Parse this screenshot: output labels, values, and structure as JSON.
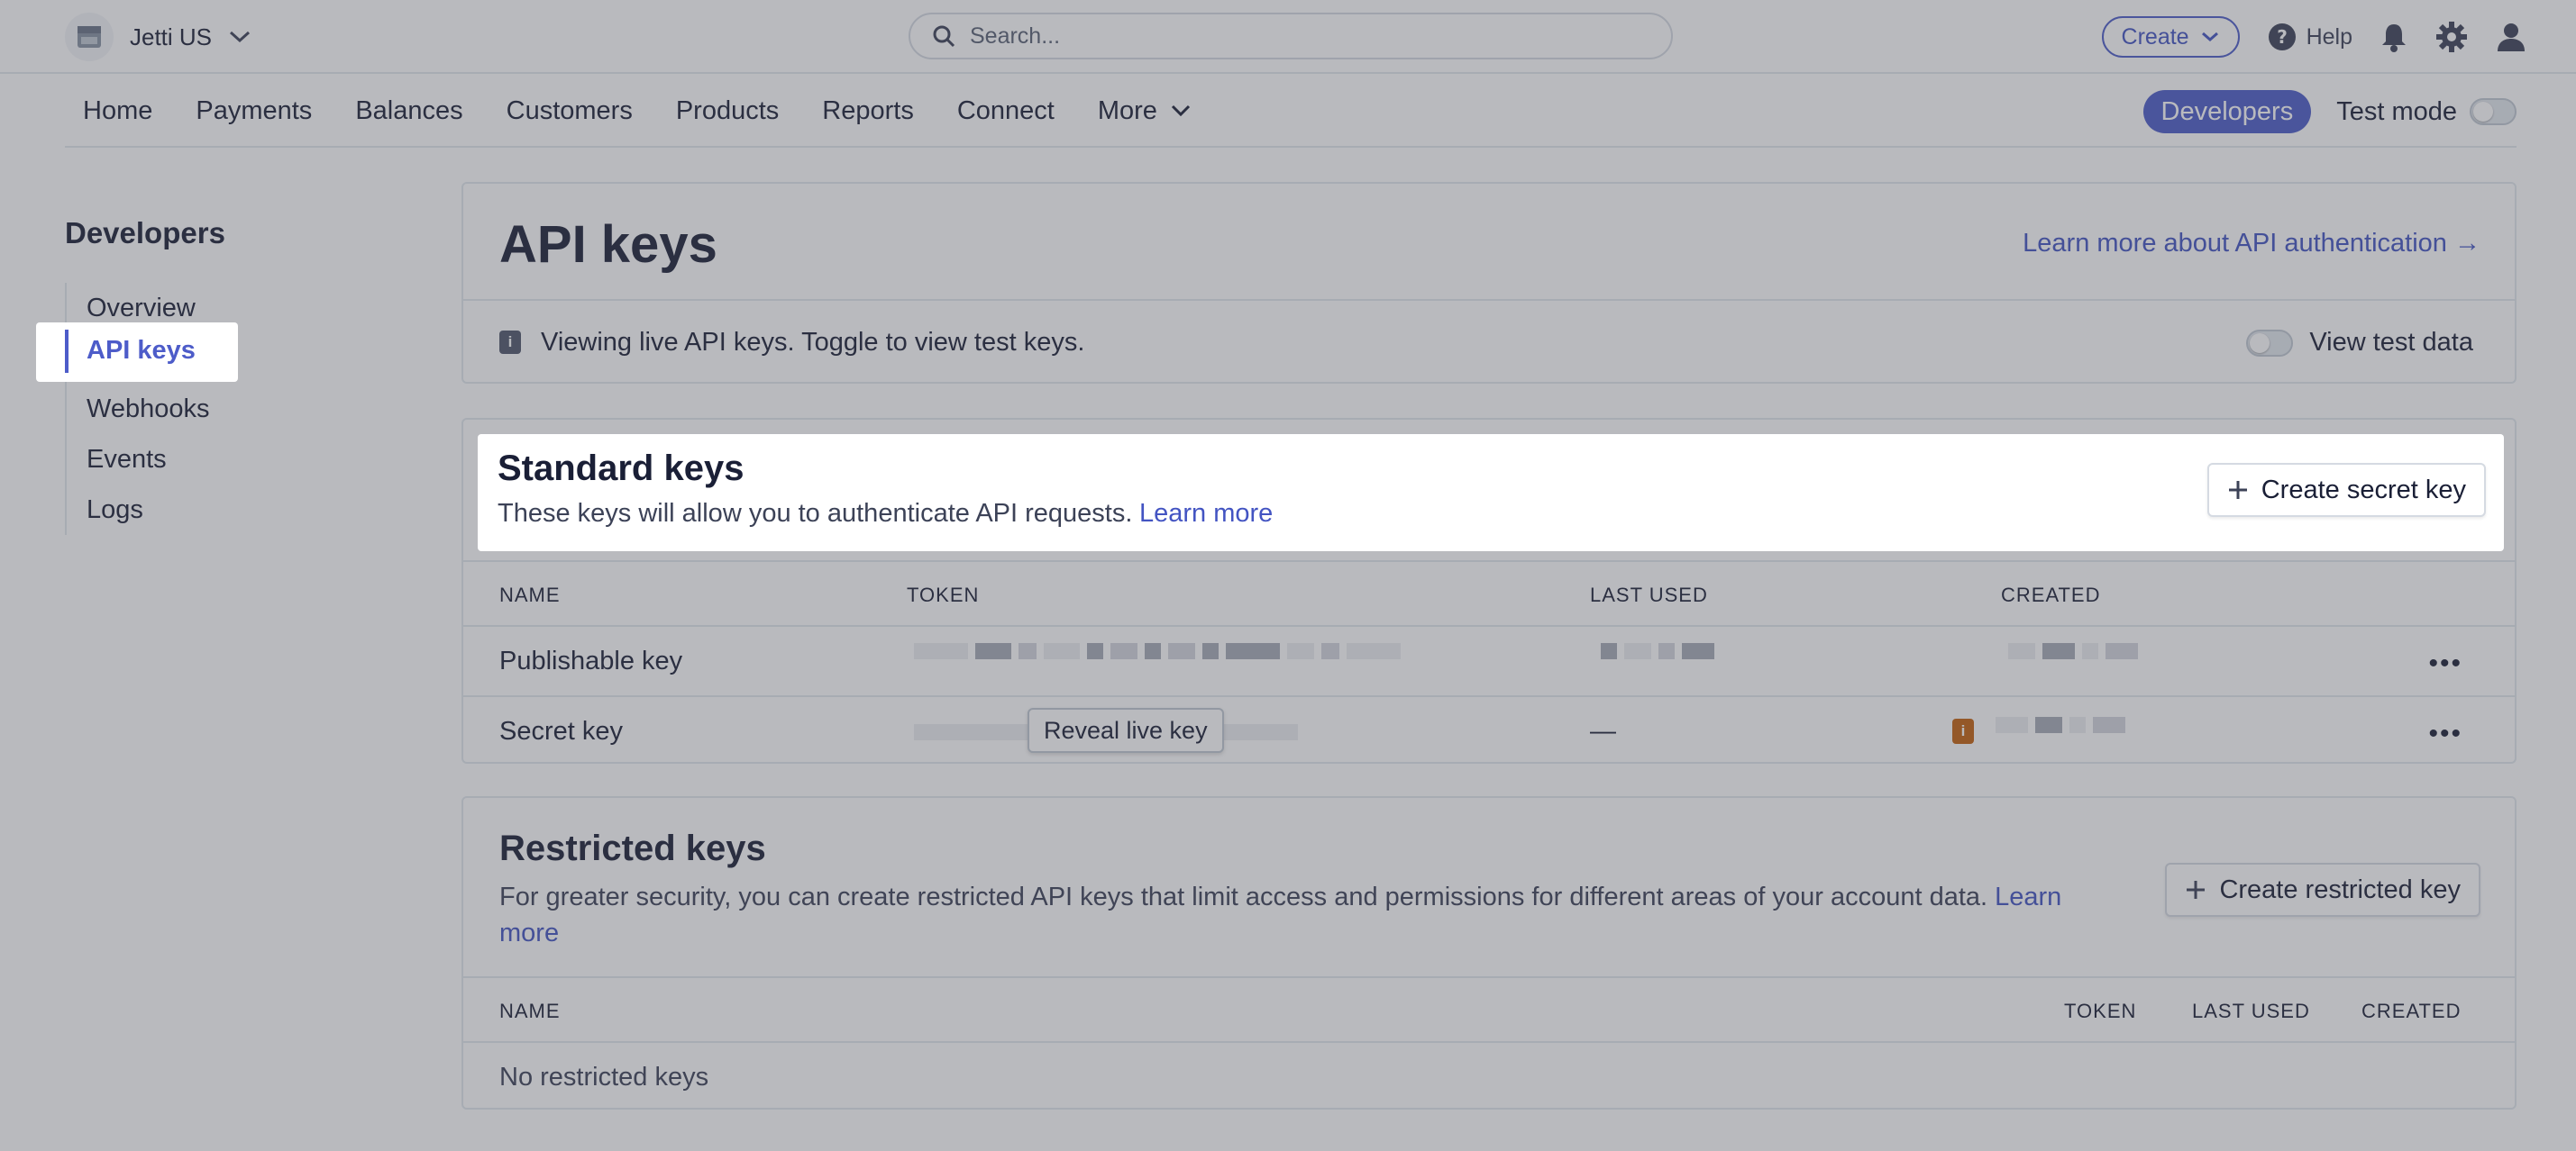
{
  "header": {
    "account_name": "Jetti US",
    "search_placeholder": "Search...",
    "create_label": "Create",
    "help_label": "Help"
  },
  "nav": {
    "items": [
      "Home",
      "Payments",
      "Balances",
      "Customers",
      "Products",
      "Reports",
      "Connect",
      "More"
    ],
    "developers_label": "Developers",
    "test_mode_label": "Test mode"
  },
  "sidebar": {
    "title": "Developers",
    "items": [
      "Overview",
      "API keys",
      "Webhooks",
      "Events",
      "Logs"
    ],
    "active_index": 1
  },
  "page": {
    "title": "API keys",
    "learn_more_link": "Learn more about API authentication →",
    "info_badge": "i",
    "info_text": "Viewing live API keys. Toggle to view test keys.",
    "view_test_data_label": "View test data"
  },
  "standard_keys": {
    "title": "Standard keys",
    "description": "These keys will allow you to authenticate API requests.",
    "learn_more": "Learn more",
    "create_button": "Create secret key",
    "columns": [
      "NAME",
      "TOKEN",
      "LAST USED",
      "CREATED"
    ],
    "rows": [
      {
        "name": "Publishable key",
        "last_used": ""
      },
      {
        "name": "Secret key",
        "reveal_button": "Reveal live key",
        "last_used": "—",
        "warning_badge": "i"
      }
    ]
  },
  "restricted_keys": {
    "title": "Restricted keys",
    "description": "For greater security, you can create restricted API keys that limit access and permissions for different areas of your account data.",
    "learn_more": "Learn more",
    "create_button": "Create restricted key",
    "columns": [
      "NAME",
      "TOKEN",
      "LAST USED",
      "CREATED"
    ],
    "empty_text": "No restricted keys"
  },
  "colors": {
    "accent": "#4d5cc9",
    "link": "#4354c2",
    "warning": "#c4610e"
  }
}
